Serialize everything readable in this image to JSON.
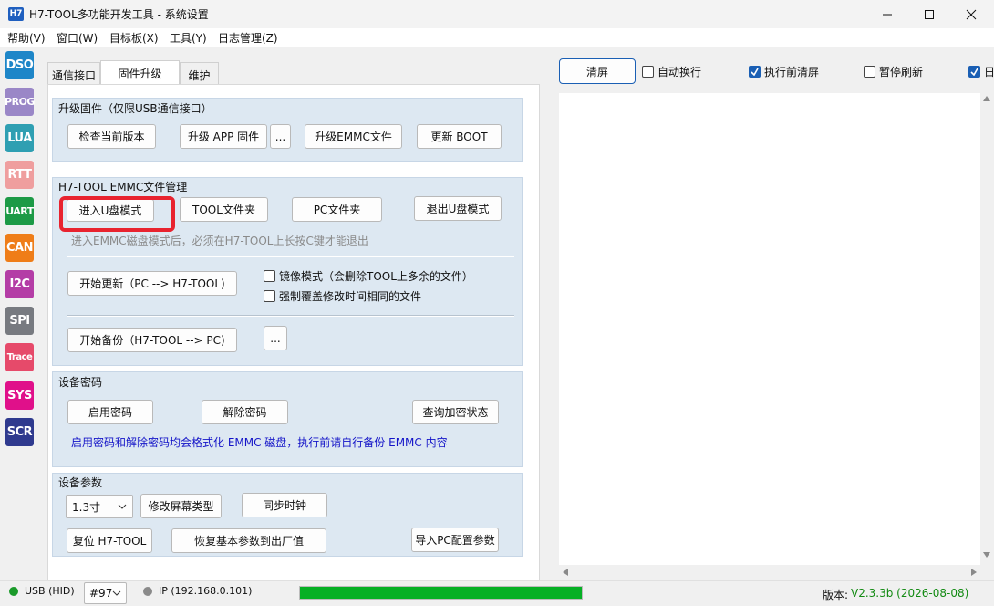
{
  "window": {
    "icon_text": "H7",
    "title": "H7-TOOL多功能开发工具 - 系统设置"
  },
  "menu": [
    "帮助(V)",
    "窗口(W)",
    "目标板(X)",
    "工具(Y)",
    "日志管理(Z)"
  ],
  "rail": [
    {
      "label": "DSO",
      "color": "#1e86c8"
    },
    {
      "label": "PROG",
      "color": "#9a87c7"
    },
    {
      "label": "LUA",
      "color": "#2f9fb2"
    },
    {
      "label": "RTT",
      "color": "#ef9e9e"
    },
    {
      "label": "UART",
      "color": "#1d9a46"
    },
    {
      "label": "CAN",
      "color": "#ef7d18"
    },
    {
      "label": "I2C",
      "color": "#b43da6"
    },
    {
      "label": "SPI",
      "color": "#777a80"
    },
    {
      "label": "Trace",
      "color": "#e64a6a"
    },
    {
      "label": "SYS",
      "color": "#e0108a"
    },
    {
      "label": "SCR",
      "color": "#2f3a8e"
    }
  ],
  "tabs": [
    "通信接口",
    "固件升级",
    "维护"
  ],
  "firmware": {
    "title": "升级固件（仅限USB通信接口）",
    "check_version": "检查当前版本",
    "upgrade_app": "升级 APP 固件",
    "browse": "...",
    "upgrade_emmc": "升级EMMC文件",
    "update_boot": "更新 BOOT"
  },
  "emmc": {
    "title": "H7-TOOL EMMC文件管理",
    "enter_udisk": "进入U盘模式",
    "tool_folder": "TOOL文件夹",
    "pc_folder": "PC文件夹",
    "exit_udisk": "退出U盘模式",
    "hint": "进入EMMC磁盘模式后，必须在H7-TOOL上长按C键才能退出",
    "start_update": "开始更新（PC --> H7-TOOL)",
    "mirror_mode": "镜像模式（会删除TOOL上多余的文件）",
    "force_overwrite": "强制覆盖修改时间相同的文件",
    "start_backup": "开始备份（H7-TOOL --> PC)",
    "backup_browse": "..."
  },
  "password": {
    "title": "设备密码",
    "enable": "启用密码",
    "remove": "解除密码",
    "query": "查询加密状态",
    "warning": "启用密码和解除密码均会格式化 EMMC 磁盘，执行前请自行备份 EMMC 内容"
  },
  "params": {
    "title": "设备参数",
    "screen_size": "1.3寸",
    "modify_screen": "修改屏幕类型",
    "sync_clock": "同步时钟",
    "reset": "复位 H7-TOOL",
    "factory_reset": "恢复基本参数到出厂值",
    "import_pc": "导入PC配置参数"
  },
  "right_toolbar": {
    "clear": "清屏",
    "auto_wrap": "自动换行",
    "clear_before_exec": "执行前清屏",
    "pause_refresh": "暂停刷新",
    "log_partial": "日"
  },
  "right_checks": {
    "auto_wrap": false,
    "clear_before_exec": true,
    "pause_refresh": false,
    "log_partial": true
  },
  "status": {
    "usb": "USB (HID)",
    "device": "#97",
    "ip": "IP (192.168.0.101)",
    "progress": 1.0,
    "version_label": "版本:",
    "version_value": "V2.3.3b (2026-08-08)"
  },
  "colors": {
    "highlight": "#e8232f",
    "link_blue": "#1414c8",
    "progress": "#06b025",
    "version": "#128a12"
  }
}
